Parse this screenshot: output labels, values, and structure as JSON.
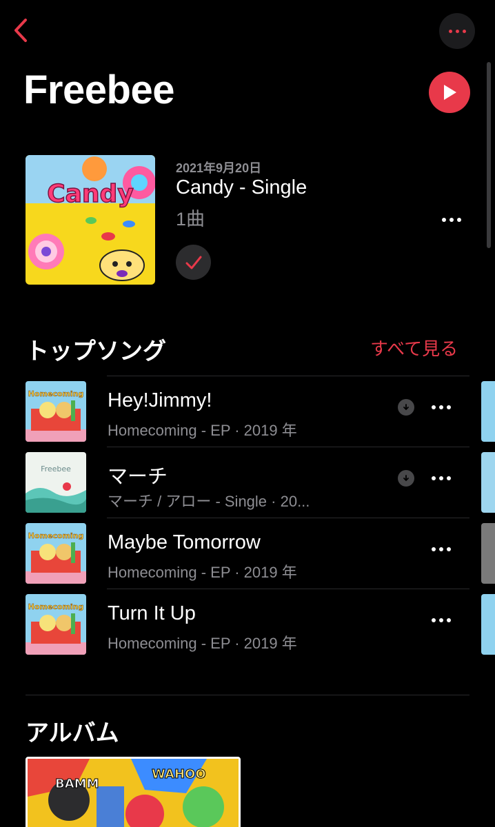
{
  "header": {
    "artist": "Freebee",
    "back_icon": "chevron-left-icon",
    "more_icon": "ellipsis-icon",
    "play_icon": "play-icon",
    "accent_color": "#e8394a"
  },
  "latest_release": {
    "date": "2021年9月20日",
    "title": "Candy - Single",
    "track_count": "1曲",
    "art_text": "Candy",
    "added_icon": "checkmark-icon"
  },
  "top_songs": {
    "heading": "トップソング",
    "see_all": "すべて見る",
    "items": [
      {
        "title": "Hey!Jimmy!",
        "subtitle": "Homecoming - EP · 2019 年",
        "art_text": "Homecoming",
        "downloadable": true
      },
      {
        "title": "マーチ",
        "subtitle": "マーチ / アロー - Single · 20...",
        "art_text": "Freebee",
        "downloadable": true
      },
      {
        "title": "Maybe Tomorrow",
        "subtitle": "Homecoming - EP · 2019 年",
        "art_text": "Homecoming",
        "downloadable": false
      },
      {
        "title": "Turn It Up",
        "subtitle": "Homecoming - EP · 2019 年",
        "art_text": "Homecoming",
        "downloadable": false
      }
    ]
  },
  "albums": {
    "heading": "アルバム"
  }
}
